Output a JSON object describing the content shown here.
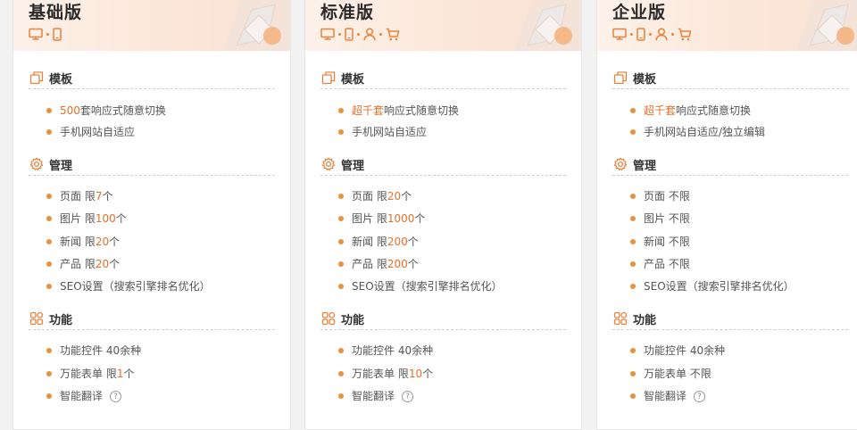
{
  "plans": [
    {
      "title": "基础版",
      "devices": [
        "desktop-icon",
        "mobile-icon"
      ],
      "template": {
        "title": "模板",
        "items": [
          {
            "pre": "",
            "hl": "500",
            "post": "套响应式随意切换"
          },
          {
            "pre": "手机网站自适应",
            "hl": "",
            "post": ""
          }
        ]
      },
      "manage": {
        "title": "管理",
        "items": [
          {
            "pre": "页面 限",
            "hl": "7",
            "post": "个"
          },
          {
            "pre": "图片 限",
            "hl": "100",
            "post": "个"
          },
          {
            "pre": "新闻 限",
            "hl": "20",
            "post": "个"
          },
          {
            "pre": "产品 限",
            "hl": "20",
            "post": "个"
          },
          {
            "pre": "SEO设置（搜索引擎排名优化）",
            "hl": "",
            "post": ""
          }
        ]
      },
      "features": {
        "title": "功能",
        "items": [
          {
            "pre": "功能控件 40余种",
            "hl": "",
            "post": ""
          },
          {
            "pre": "万能表单 限",
            "hl": "1",
            "post": "个"
          },
          {
            "pre": "智能翻译",
            "hl": "",
            "post": "",
            "help": "?"
          }
        ]
      }
    },
    {
      "title": "标准版",
      "devices": [
        "desktop-icon",
        "mobile-icon",
        "user-icon",
        "cart-icon"
      ],
      "template": {
        "title": "模板",
        "items": [
          {
            "pre": "",
            "hl": "超千套",
            "post": "响应式随意切换"
          },
          {
            "pre": "手机网站自适应",
            "hl": "",
            "post": ""
          }
        ]
      },
      "manage": {
        "title": "管理",
        "items": [
          {
            "pre": "页面 限",
            "hl": "20",
            "post": "个"
          },
          {
            "pre": "图片 限",
            "hl": "1000",
            "post": "个"
          },
          {
            "pre": "新闻 限",
            "hl": "200",
            "post": "个"
          },
          {
            "pre": "产品 限",
            "hl": "200",
            "post": "个"
          },
          {
            "pre": "SEO设置（搜索引擎排名优化）",
            "hl": "",
            "post": ""
          }
        ]
      },
      "features": {
        "title": "功能",
        "items": [
          {
            "pre": "功能控件 40余种",
            "hl": "",
            "post": ""
          },
          {
            "pre": "万能表单 限",
            "hl": "10",
            "post": "个"
          },
          {
            "pre": "智能翻译",
            "hl": "",
            "post": "",
            "help": "?"
          }
        ]
      }
    },
    {
      "title": "企业版",
      "devices": [
        "desktop-icon",
        "mobile-icon",
        "user-icon",
        "cart-icon"
      ],
      "template": {
        "title": "模板",
        "items": [
          {
            "pre": "",
            "hl": "超千套",
            "post": "响应式随意切换"
          },
          {
            "pre": "手机网站自适应/独立编辑",
            "hl": "",
            "post": ""
          }
        ]
      },
      "manage": {
        "title": "管理",
        "items": [
          {
            "pre": "页面 不限",
            "hl": "",
            "post": ""
          },
          {
            "pre": "图片 不限",
            "hl": "",
            "post": ""
          },
          {
            "pre": "新闻 不限",
            "hl": "",
            "post": ""
          },
          {
            "pre": "产品 不限",
            "hl": "",
            "post": ""
          },
          {
            "pre": "SEO设置（搜索引擎排名优化）",
            "hl": "",
            "post": ""
          }
        ]
      },
      "features": {
        "title": "功能",
        "items": [
          {
            "pre": "功能控件 40余种",
            "hl": "",
            "post": ""
          },
          {
            "pre": "万能表单 不限",
            "hl": "",
            "post": ""
          },
          {
            "pre": "智能翻译",
            "hl": "",
            "post": "",
            "help": "?"
          }
        ]
      }
    }
  ],
  "colors": {
    "accent": "#e8702a",
    "bullet": "#e8913e"
  }
}
